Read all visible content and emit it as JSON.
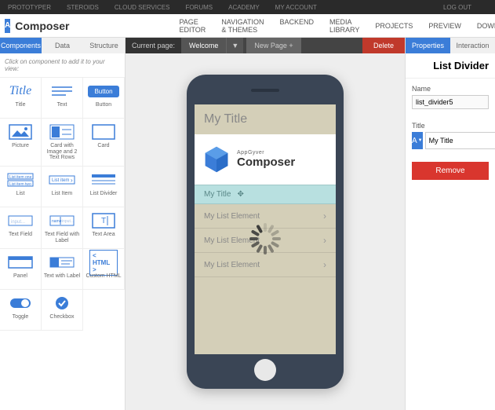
{
  "topnav": {
    "items": [
      "PROTOTYPER",
      "STEROIDS",
      "CLOUD SERVICES",
      "FORUMS",
      "ACADEMY",
      "MY ACCOUNT"
    ],
    "logout": "LOG OUT"
  },
  "titlebar": {
    "logo": "A",
    "app": "Composer",
    "tabs": [
      "PAGE EDITOR",
      "NAVIGATION & THEMES",
      "BACKEND",
      "MEDIA LIBRARY"
    ],
    "right": [
      "PROJECTS",
      "PREVIEW",
      "DOWNLOAD"
    ]
  },
  "left": {
    "tabs": [
      "Components",
      "Data",
      "Structure"
    ],
    "hint": "Click on component to add it to your view:",
    "components": [
      {
        "label": "Title",
        "icon": "title"
      },
      {
        "label": "Text",
        "icon": "text"
      },
      {
        "label": "Button",
        "icon": "button"
      },
      {
        "label": "Picture",
        "icon": "picture"
      },
      {
        "label": "Card with Image and 2 Text Rows",
        "icon": "card-img"
      },
      {
        "label": "Card",
        "icon": "card"
      },
      {
        "label": "List",
        "icon": "list"
      },
      {
        "label": "List Item",
        "icon": "list-item"
      },
      {
        "label": "List Divider",
        "icon": "list-divider"
      },
      {
        "label": "Text Field",
        "icon": "textfield"
      },
      {
        "label": "Text Field with Label",
        "icon": "textfield-label"
      },
      {
        "label": "Text Area",
        "icon": "textarea"
      },
      {
        "label": "Panel",
        "icon": "panel"
      },
      {
        "label": "Text with Label",
        "icon": "text-label"
      },
      {
        "label": "Custom HTML",
        "icon": "html"
      },
      {
        "label": "Toggle",
        "icon": "toggle"
      },
      {
        "label": "Checkbox",
        "icon": "checkbox"
      }
    ]
  },
  "pagebar": {
    "label": "Current page:",
    "current": "Welcome",
    "new": "New Page +",
    "delete": "Delete"
  },
  "phone": {
    "header": "My Title",
    "logo_top": "AppGyver",
    "logo_bottom": "Composer",
    "divider": "My Title",
    "rows": [
      "My List Element",
      "My List Element",
      "My List Element"
    ]
  },
  "right": {
    "tabs": [
      "Properties",
      "Interaction"
    ],
    "title": "List Divider",
    "name_label": "Name",
    "name_value": "list_divider5",
    "title_label": "Title",
    "title_value": "My Title",
    "font_btn": "A",
    "remove": "Remove"
  }
}
